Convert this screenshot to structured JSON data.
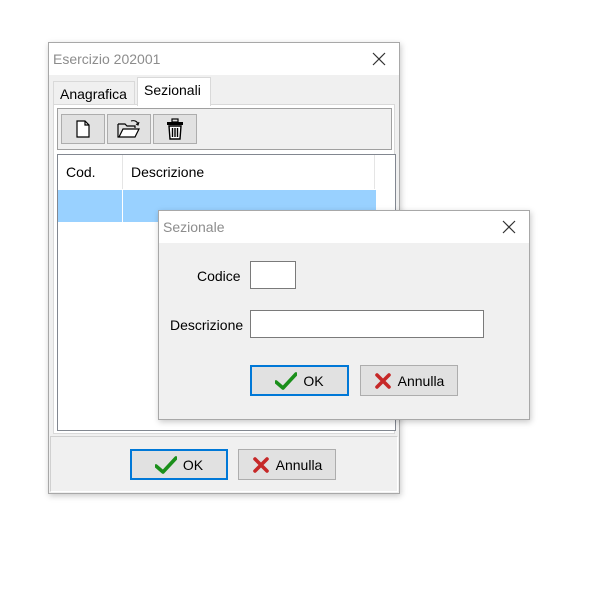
{
  "main_window": {
    "title": "Esercizio 202001",
    "tabs": [
      {
        "label": "Anagrafica"
      },
      {
        "label": "Sezionali"
      }
    ],
    "toolbar": {
      "icons": [
        "new-file-icon",
        "open-folder-icon",
        "trash-icon"
      ]
    },
    "list": {
      "columns": [
        "Cod.",
        "Descrizione"
      ],
      "rows": [
        {
          "code": "",
          "description": "",
          "selected": true
        }
      ]
    },
    "buttons": {
      "ok": "OK",
      "cancel": "Annulla"
    }
  },
  "sub_dialog": {
    "title": "Sezionale",
    "fields": {
      "code_label": "Codice",
      "code_value": "",
      "description_label": "Descrizione",
      "description_value": ""
    },
    "buttons": {
      "ok": "OK",
      "cancel": "Annulla"
    }
  },
  "colors": {
    "selection": "#99d1ff",
    "default_button_border": "#0078d7",
    "ok_check": "#1a8f1a",
    "cancel_x": "#c62828",
    "title_text": "#8c8c8c"
  }
}
